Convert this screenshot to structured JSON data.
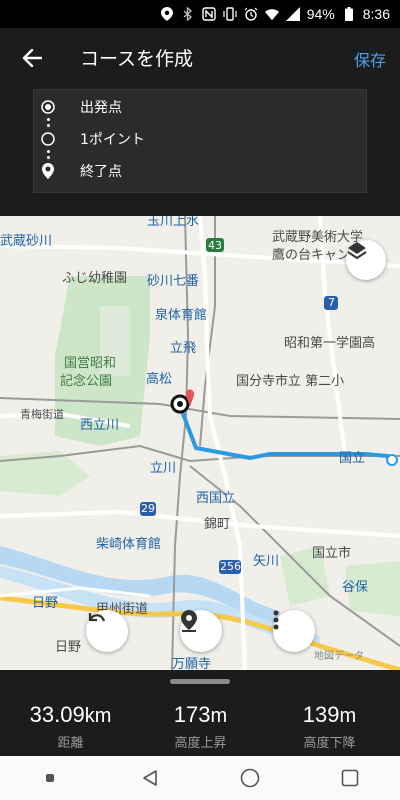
{
  "status_bar": {
    "battery": "94%",
    "time": "8:36",
    "icons": [
      "location-icon",
      "bluetooth-icon",
      "nfc-icon",
      "vibrate-icon",
      "alarm-icon",
      "wifi-icon",
      "signal-icon",
      "battery-icon"
    ]
  },
  "header": {
    "title": "コースを作成",
    "save_label": "保存",
    "back_icon": "back-arrow-icon"
  },
  "route": {
    "points": [
      {
        "label": "出発点",
        "icon": "start-point-icon"
      },
      {
        "label": "1ポイント",
        "icon": "waypoint-icon"
      },
      {
        "label": "終了点",
        "icon": "end-pin-icon"
      }
    ]
  },
  "map": {
    "labels": {
      "tamagawajosui": "玉川上水",
      "musashisunagawa": "武蔵砂川",
      "bijutsu": "武蔵野美術大学",
      "takanodai": "鷹の台キャン",
      "fujiyochien": "ふじ幼稚園",
      "sunagawa7": "砂川七番",
      "izumitaiikukan": "泉体育館",
      "showadaiichi": "昭和第一学園高",
      "tachihi": "立飛",
      "kokueishowa": "国営昭和",
      "kinenkoen": "記念公園",
      "takamatsu": "高松",
      "kokubunji2": "国分寺市立 第二小",
      "aomekaido": "青梅街道",
      "nishitachikawa": "西立川",
      "kunitachi": "国立",
      "tachikawa": "立川",
      "nishikunitachi": "西国立",
      "nishikicho": "錦町",
      "shibasaki": "柴崎体育館",
      "yagawa": "矢川",
      "kunitachishi": "国立市",
      "hino": "日野",
      "kofukaido": "甲州街道",
      "yaho": "谷保",
      "hino2": "日野",
      "manganji": "万願寺",
      "route43": "43",
      "route7": "7",
      "route29": "29",
      "route256": "256"
    },
    "copyright": "地図データ",
    "route_color": "#2b9ae0",
    "marker_color": "#e8505b"
  },
  "controls": {
    "layers_icon": "layers-icon",
    "undo_icon": "undo-icon",
    "add_pin_icon": "add-pin-icon",
    "more_icon": "more-vertical-icon"
  },
  "stats": [
    {
      "value": "33.09",
      "unit": "km",
      "label": "距離"
    },
    {
      "value": "173",
      "unit": "m",
      "label": "高度上昇"
    },
    {
      "value": "139",
      "unit": "m",
      "label": "高度下降"
    }
  ],
  "nav": {
    "icons": [
      "recents-dot-icon",
      "back-triangle-icon",
      "home-circle-icon",
      "overview-square-icon"
    ]
  }
}
